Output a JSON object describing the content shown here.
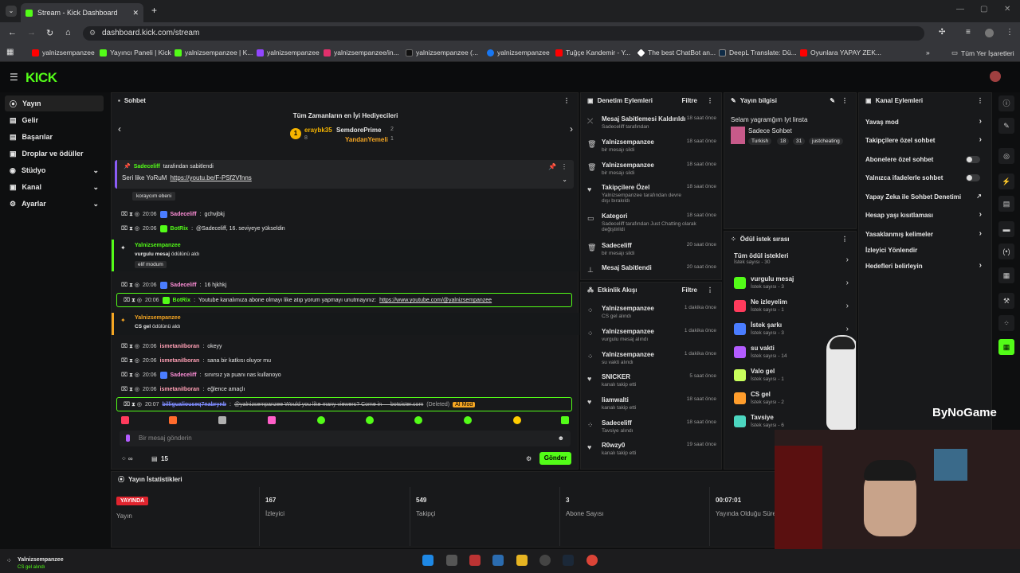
{
  "browser": {
    "tab_title": "Stream - Kick Dashboard",
    "url": "dashboard.kick.com/stream",
    "bookmarks": [
      "yalnizsempanzee",
      "Yayıncı Paneli | Kick",
      "yalnizsempanzee | K...",
      "yalnizsempanzee",
      "yalnizsempanzee/in...",
      "yalnizsempanzee (...",
      "yalnizsempanzee",
      "Tuğçe Kandemir - Y...",
      "The best ChatBot an...",
      "DeepL Translate: Dü...",
      "Oyunlara YAPAY ZEK..."
    ],
    "all_bookmarks": "Tüm Yer İşaretleri"
  },
  "kick": {
    "logo": "KICK"
  },
  "nav": {
    "items": [
      "Yayın",
      "Gelir",
      "Başarılar",
      "Droplar ve ödüller",
      "Stüdyo",
      "Kanal",
      "Ayarlar"
    ]
  },
  "chat": {
    "title": "Sohbet",
    "gifters_title": "Tüm Zamanların en İyi Hediyecileri",
    "gifters": [
      {
        "name": "eraybk35",
        "count": "8",
        "rank": "1"
      },
      {
        "name": "SemdorePrime",
        "count": "2"
      },
      {
        "name": "YandanYemeli",
        "count": "1"
      }
    ],
    "pinned_by": "Sadeceliff",
    "pinned_suffix": "tarafından sabitlendi",
    "pinned_text": "Seri like YoRuM",
    "pinned_link": "https://youtu.be/F-PSf2Vfnns",
    "reward_label": "koraycım ebeni",
    "messages": [
      {
        "time": "20:06",
        "user": "Sadeceliff",
        "text": "gchvjbkj",
        "color": "#ff8fd8"
      },
      {
        "time": "20:06",
        "user": "BotRix",
        "text": "@Sadeceliff, 16. seviyeye yükseldin",
        "color": "#53fc18"
      },
      {
        "time": "20:06",
        "user": "Sadeceliff",
        "text": "16 hjkhkj",
        "color": "#ff8fd8"
      },
      {
        "time": "20:06",
        "user": "BotRix",
        "text": "Youtube kanalımıza abone olmayı like atıp yorum yapmayı unutmayınız:",
        "link": "https://www.youtube.com/@yalnizsempanzee",
        "color": "#53fc18"
      },
      {
        "time": "20:06",
        "user": "ismetaniIboran",
        "text": "okeyy",
        "color": "#ff9fb4"
      },
      {
        "time": "20:06",
        "user": "ismetaniIboran",
        "text": "sana bir katkısı oluyor mu",
        "color": "#ff9fb4"
      },
      {
        "time": "20:06",
        "user": "Sadeceliff",
        "text": "sınırsız ya puanı nas kullanoyo",
        "color": "#ff8fd8"
      },
      {
        "time": "20:06",
        "user": "ismetaniIboran",
        "text": "eğlence amaçlı",
        "color": "#ff9fb4"
      },
      {
        "time": "20:07",
        "user": "billigualiouseq7nabrynb",
        "text": "@yalnizsempanzee Would you like many viewers? Come in — botsister.com",
        "deleted": "(Deleted)",
        "mod": "AI Mod",
        "color": "#7f8cff"
      }
    ],
    "redeem1": {
      "user": "Yalnizsempanzee",
      "text": "vurgulu mesaj",
      "suffix": "ödülünü aldı",
      "tag": "elif modum"
    },
    "redeem2": {
      "user": "Yalnizsempanzee",
      "text": "CS gel",
      "suffix": "ödülünü aldı"
    },
    "input_placeholder": "Bir mesaj gönderin",
    "points": "15",
    "send": "Gönder",
    "emotes": [
      "#ff3b5c",
      "#ff6b2c",
      "#b0b0b0",
      "#ff5ec8",
      "#53fc18",
      "#53fc18",
      "#53fc18",
      "#53fc18",
      "#ffcc00",
      "#53fc18"
    ]
  },
  "mod": {
    "title": "Denetim Eylemleri",
    "filter": "Filtre",
    "items": [
      {
        "title": "Mesaj Sabitlemesi Kaldırıldı",
        "sub": "Sadeceliff tarafından",
        "time": "18 saat önce",
        "icon": "pin-off-icon"
      },
      {
        "title": "Yalnizsempanzee",
        "sub": "bir mesajı sildi",
        "time": "18 saat önce",
        "icon": "trash-icon"
      },
      {
        "title": "Yalnizsempanzee",
        "sub": "bir mesajı sildi",
        "time": "18 saat önce",
        "icon": "trash-icon"
      },
      {
        "title": "Takipçilere Özel",
        "sub": "Yalnizsempanzee tarafından devre dışı bırakıldı",
        "time": "18 saat önce",
        "icon": "heart-icon"
      },
      {
        "title": "Kategori",
        "sub": "Sadeceliff tarafından Just Chatting olarak değiştirildi",
        "time": "18 saat önce",
        "icon": "category-icon"
      },
      {
        "title": "Sadeceliff",
        "sub": "bir mesajı sildi",
        "time": "20 saat önce",
        "icon": "trash-icon"
      },
      {
        "title": "Mesaj Sabitlendi",
        "sub": "",
        "time": "20 saat önce",
        "icon": "pin-icon"
      }
    ]
  },
  "activity": {
    "title": "Etkinlik Akışı",
    "filter": "Filtre",
    "items": [
      {
        "title": "Yalnizsempanzee",
        "sub": "CS gel alındı",
        "time": "1 dakika önce",
        "icon": "reward-icon"
      },
      {
        "title": "Yalnizsempanzee",
        "sub": "vurgulu mesaj alındı",
        "time": "1 dakika önce",
        "icon": "reward-icon"
      },
      {
        "title": "Yalnizsempanzee",
        "sub": "su vakti alındı",
        "time": "1 dakika önce",
        "icon": "reward-icon"
      },
      {
        "title": "SNICKER",
        "sub": "kanalı takip etti",
        "time": "5 saat önce",
        "icon": "heart-icon"
      },
      {
        "title": "liamwalti",
        "sub": "kanalı takip etti",
        "time": "18 saat önce",
        "icon": "heart-icon"
      },
      {
        "title": "Sadeceliff",
        "sub": "Tavsiye alındı",
        "time": "18 saat önce",
        "icon": "reward-icon"
      },
      {
        "title": "R0wzy0",
        "sub": "kanalı takip etti",
        "time": "19 saat önce",
        "icon": "heart-icon"
      }
    ]
  },
  "stream_info": {
    "title": "Yayın bilgisi",
    "stream_title": "Selam yagramğım Iyt linsta",
    "category": "Sadece Sohbet",
    "tags": [
      "Turkish",
      "18",
      "31",
      "justcheating"
    ]
  },
  "rewards": {
    "title": "Ödül istek sırası",
    "all": "Tüm ödül istekleri",
    "all_count": "İstek sayısı - 30",
    "items": [
      {
        "name": "vurgulu mesaj",
        "count": "İstek sayısı - 3",
        "color": "#53fc18"
      },
      {
        "name": "Ne izleyelim",
        "count": "İstek sayısı - 1",
        "color": "#ff3b5c"
      },
      {
        "name": "İstek şarkı",
        "count": "İstek sayısı - 3",
        "color": "#4a7dff"
      },
      {
        "name": "su vakti",
        "count": "İstek sayısı - 14",
        "color": "#b35cff"
      },
      {
        "name": "Valo gel",
        "count": "İstek sayısı - 1",
        "color": "#c8ff5c"
      },
      {
        "name": "CS gel",
        "count": "İstek sayısı - 2",
        "color": "#ff9d2c"
      },
      {
        "name": "Tavsiye",
        "count": "İstek sayısı - 6",
        "color": "#4cd6c0"
      }
    ]
  },
  "channel": {
    "title": "Kanal Eylemleri",
    "items": [
      "Yavaş mod",
      "Takipçilere özel sohbet",
      "Abonelere özel sohbet",
      "Yalnızca ifadelerle sohbet",
      "Yapay Zeka ile Sohbet Denetimi",
      "Hesap yaşı kısıtlaması",
      "Yasaklanmış kelimeler",
      "İzleyici Yönlendir",
      "Hedefleri belirleyin"
    ]
  },
  "stats": {
    "title": "Yayın İstatistikleri",
    "live": "YAYINDA",
    "live_label": "Yayın",
    "viewers": "167",
    "viewers_label": "İzleyici",
    "followers": "549",
    "followers_label": "Takipçi",
    "subs": "3",
    "subs_label": "Abone Sayısı",
    "uptime": "00:07:01",
    "uptime_label": "Yayında Olduğu Süre"
  },
  "footer": {
    "user": "Yalnizsempanzee",
    "sub": "CS gel alındı"
  },
  "watermark": "ByNoGame"
}
